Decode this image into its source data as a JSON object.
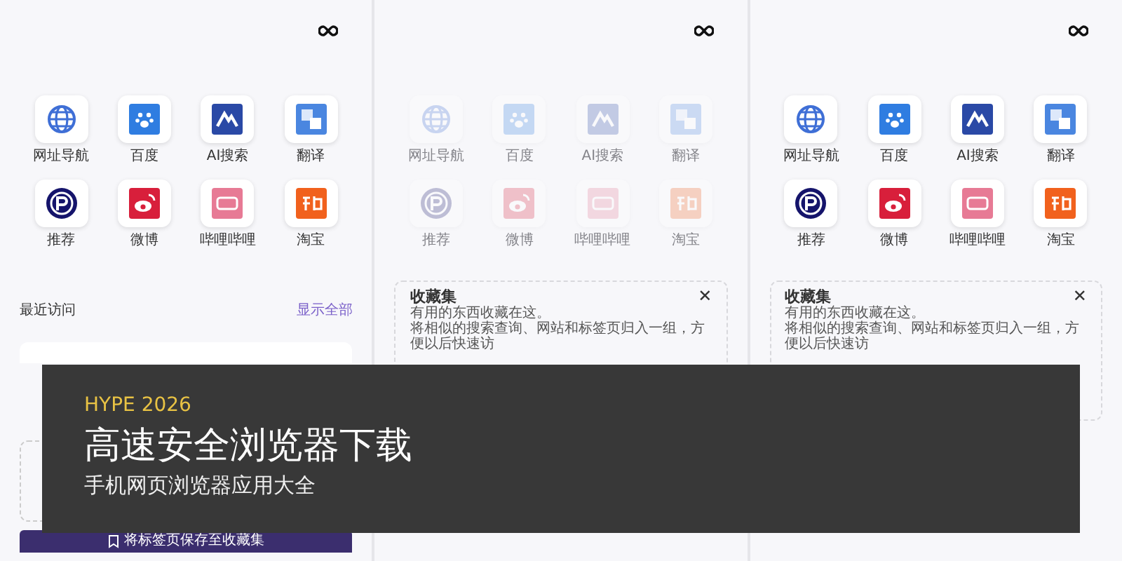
{
  "screens": [
    {
      "dimmed": false,
      "shortcuts": [
        {
          "label": "网址导航",
          "kind": "globe"
        },
        {
          "label": "百度",
          "kind": "paw"
        },
        {
          "label": "AI搜索",
          "kind": "peaks"
        },
        {
          "label": "翻译",
          "kind": "translate"
        },
        {
          "label": "推荐",
          "kind": "ring"
        },
        {
          "label": "微博",
          "kind": "swirl"
        },
        {
          "label": "哔哩哔哩",
          "kind": "tv"
        },
        {
          "label": "淘宝",
          "kind": "shop"
        }
      ],
      "recent": {
        "title": "最近访问",
        "link": "显示全部"
      },
      "save_button": "将标签页保存至收藏集"
    },
    {
      "dimmed": true,
      "shortcuts": [
        {
          "label": "网址导航",
          "kind": "globe"
        },
        {
          "label": "百度",
          "kind": "paw"
        },
        {
          "label": "AI搜索",
          "kind": "peaks"
        },
        {
          "label": "翻译",
          "kind": "translate"
        },
        {
          "label": "推荐",
          "kind": "ring"
        },
        {
          "label": "微博",
          "kind": "swirl"
        },
        {
          "label": "哔哩哔哩",
          "kind": "tv"
        },
        {
          "label": "淘宝",
          "kind": "shop"
        }
      ],
      "collection": {
        "title": "收藏集",
        "close": "✕",
        "line_1": "有用的东西收藏在这。",
        "line_2": "将相似的搜索查询、网站和标签页归入一组，方便以后快速访"
      }
    },
    {
      "dimmed": false,
      "shortcuts": [
        {
          "label": "网址导航",
          "kind": "globe"
        },
        {
          "label": "百度",
          "kind": "paw"
        },
        {
          "label": "AI搜索",
          "kind": "peaks"
        },
        {
          "label": "翻译",
          "kind": "translate"
        },
        {
          "label": "推荐",
          "kind": "ring"
        },
        {
          "label": "微博",
          "kind": "swirl"
        },
        {
          "label": "哔哩哔哩",
          "kind": "tv"
        },
        {
          "label": "淘宝",
          "kind": "shop"
        }
      ],
      "collection": {
        "title": "收藏集",
        "close": "✕",
        "line_1": "有用的东西收藏在这。",
        "line_2": "将相似的搜索查询、网站和标签页归入一组，方便以后快速访"
      }
    }
  ],
  "banner": {
    "kicker": "HYPE 2026",
    "title": "高速安全浏览器下载",
    "subtitle": "手机网页浏览器应用大全"
  }
}
